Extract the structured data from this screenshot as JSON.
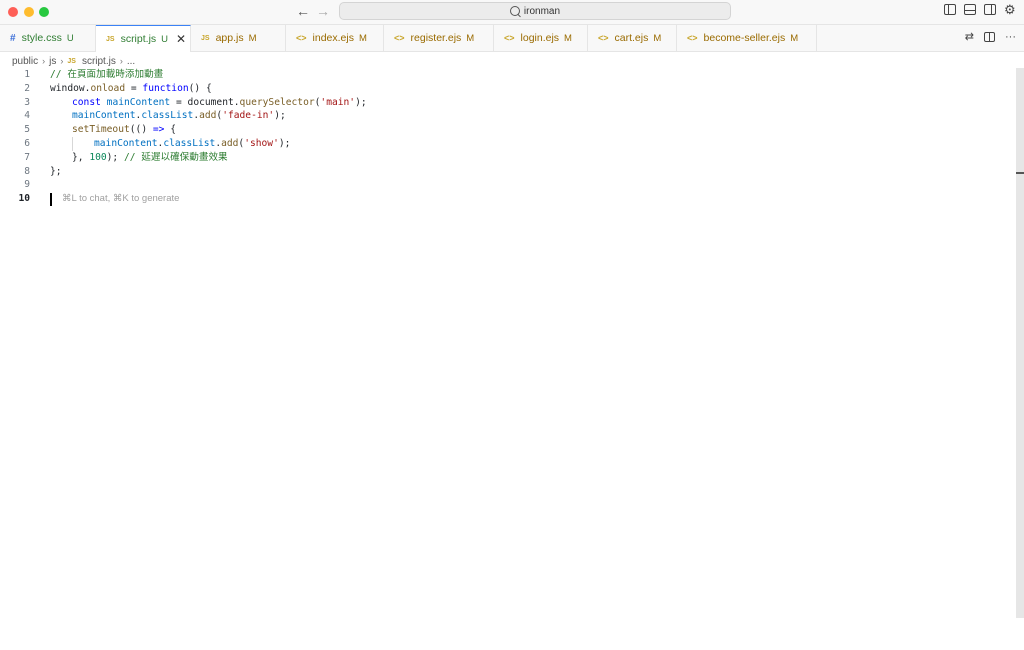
{
  "window": {
    "search_text": "ironman"
  },
  "tabs": [
    {
      "icon": "#",
      "type": "css",
      "name": "style.css",
      "badge": "U",
      "status": "u",
      "active": false
    },
    {
      "icon": "JS",
      "type": "js",
      "name": "script.js",
      "badge": "U",
      "status": "u",
      "active": true
    },
    {
      "icon": "JS",
      "type": "js",
      "name": "app.js",
      "badge": "M",
      "status": "m",
      "active": false
    },
    {
      "icon": "<>",
      "type": "ejs",
      "name": "index.ejs",
      "badge": "M",
      "status": "m",
      "active": false
    },
    {
      "icon": "<>",
      "type": "ejs",
      "name": "register.ejs",
      "badge": "M",
      "status": "m",
      "active": false
    },
    {
      "icon": "<>",
      "type": "ejs",
      "name": "login.ejs",
      "badge": "M",
      "status": "m",
      "active": false
    },
    {
      "icon": "<>",
      "type": "ejs",
      "name": "cart.ejs",
      "badge": "M",
      "status": "m",
      "active": false
    },
    {
      "icon": "<>",
      "type": "ejs",
      "name": "become-seller.ejs",
      "badge": "M",
      "status": "m",
      "active": false
    }
  ],
  "breadcrumb": {
    "folder1": "public",
    "folder2": "js",
    "file_icon": "JS",
    "file": "script.js",
    "more": "..."
  },
  "editor": {
    "current_line": 10,
    "hint": "⌘L to chat, ⌘K to generate",
    "lines": [
      {
        "n": 1,
        "indent": 0,
        "tokens": [
          [
            "c-comment",
            "// 在頁面加載時添加動畫"
          ]
        ]
      },
      {
        "n": 2,
        "indent": 0,
        "tokens": [
          [
            "c-plain",
            "window"
          ],
          [
            "c-plain",
            "."
          ],
          [
            "c-fn",
            "onload"
          ],
          [
            "c-plain",
            " = "
          ],
          [
            "c-kw",
            "function"
          ],
          [
            "c-plain",
            "() {"
          ]
        ]
      },
      {
        "n": 3,
        "indent": 1,
        "tokens": [
          [
            "c-kw",
            "const"
          ],
          [
            "c-plain",
            " "
          ],
          [
            "c-var",
            "mainContent"
          ],
          [
            "c-plain",
            " = "
          ],
          [
            "c-plain",
            "document"
          ],
          [
            "c-plain",
            "."
          ],
          [
            "c-fn",
            "querySelector"
          ],
          [
            "c-plain",
            "("
          ],
          [
            "c-str",
            "'main'"
          ],
          [
            "c-plain",
            ");"
          ]
        ]
      },
      {
        "n": 4,
        "indent": 1,
        "tokens": [
          [
            "c-var",
            "mainContent"
          ],
          [
            "c-plain",
            "."
          ],
          [
            "c-var",
            "classList"
          ],
          [
            "c-plain",
            "."
          ],
          [
            "c-fn",
            "add"
          ],
          [
            "c-plain",
            "("
          ],
          [
            "c-str",
            "'fade-in'"
          ],
          [
            "c-plain",
            ");"
          ]
        ]
      },
      {
        "n": 5,
        "indent": 1,
        "tokens": [
          [
            "c-fn",
            "setTimeout"
          ],
          [
            "c-plain",
            "(() "
          ],
          [
            "c-kw",
            "=>"
          ],
          [
            "c-plain",
            " {"
          ]
        ]
      },
      {
        "n": 6,
        "indent": 2,
        "tokens": [
          [
            "c-var",
            "mainContent"
          ],
          [
            "c-plain",
            "."
          ],
          [
            "c-var",
            "classList"
          ],
          [
            "c-plain",
            "."
          ],
          [
            "c-fn",
            "add"
          ],
          [
            "c-plain",
            "("
          ],
          [
            "c-str",
            "'show'"
          ],
          [
            "c-plain",
            ");"
          ]
        ]
      },
      {
        "n": 7,
        "indent": 1,
        "tokens": [
          [
            "c-plain",
            "}, "
          ],
          [
            "c-num",
            "100"
          ],
          [
            "c-plain",
            "); "
          ],
          [
            "c-comment",
            "// 延遲以確保動畫效果"
          ]
        ]
      },
      {
        "n": 8,
        "indent": 0,
        "tokens": [
          [
            "c-plain",
            "};"
          ]
        ]
      },
      {
        "n": 9,
        "indent": 0,
        "tokens": []
      },
      {
        "n": 10,
        "indent": 0,
        "tokens": []
      }
    ]
  }
}
